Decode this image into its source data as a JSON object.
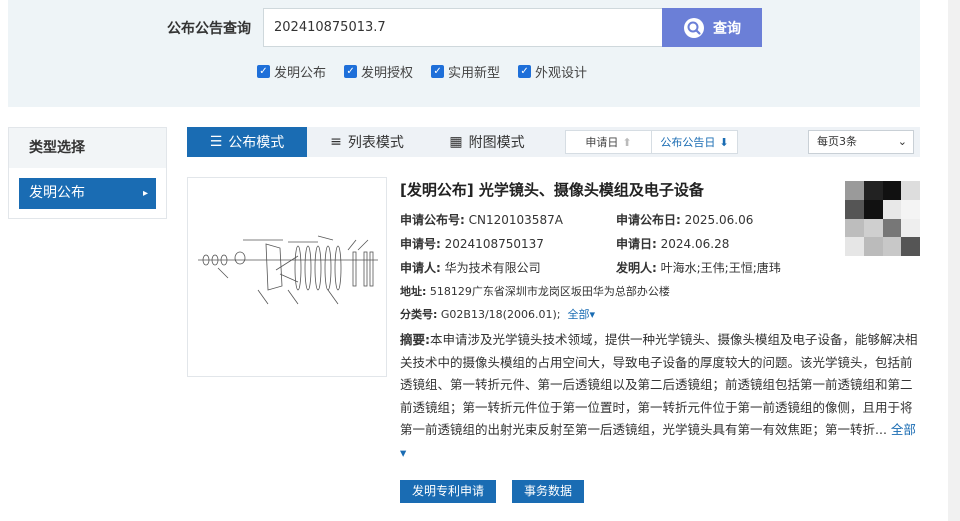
{
  "search": {
    "label": "公布公告查询",
    "value": "202410875013.7",
    "button_label": "查询"
  },
  "filters": [
    {
      "label": "发明公布",
      "checked": true
    },
    {
      "label": "发明授权",
      "checked": true
    },
    {
      "label": "实用新型",
      "checked": true
    },
    {
      "label": "外观设计",
      "checked": true
    }
  ],
  "sidebar": {
    "title": "类型选择",
    "items": [
      {
        "label": "发明公布",
        "active": true
      }
    ]
  },
  "view_modes": [
    {
      "label": "公布模式",
      "icon": "list-icon",
      "active": true
    },
    {
      "label": "列表模式",
      "icon": "menu-icon",
      "active": false
    },
    {
      "label": "附图模式",
      "icon": "grid-icon",
      "active": false
    }
  ],
  "sort": {
    "apply_date": "申请日",
    "pub_date": "公布公告日"
  },
  "per_page": "每页3条",
  "result": {
    "title": "[发明公布] 光学镜头、摄像头模组及电子设备",
    "pub_no_label": "申请公布号:",
    "pub_no": "CN120103587A",
    "pub_date_label": "申请公布日:",
    "pub_date": "2025.06.06",
    "app_no_label": "申请号:",
    "app_no": "2024108750137",
    "app_date_label": "申请日:",
    "app_date": "2024.06.28",
    "applicant_label": "申请人:",
    "applicant": "华为技术有限公司",
    "inventor_label": "发明人:",
    "inventors": "叶海水;王伟;王恒;唐玮",
    "address_label": "地址:",
    "address": "518129广东省深圳市龙岗区坂田华为总部办公楼",
    "class_label": "分类号:",
    "class_no": "G02B13/18(2006.01);",
    "class_all": "全部▾",
    "abstract_label": "摘要:",
    "abstract": "本申请涉及光学镜头技术领域，提供一种光学镜头、摄像头模组及电子设备，能够解决相关技术中的摄像头模组的占用空间大，导致电子设备的厚度较大的问题。该光学镜头，包括前透镜组、第一转折元件、第一后透镜组以及第二后透镜组；前透镜组包括第一前透镜组和第二前透镜组；第一转折元件位于第一位置时，第一转折元件位于第一前透镜组的像侧，且用于将第一前透镜组的出射光束反射至第一后透镜组，光学镜头具有第一有效焦距；第一转折...",
    "abstract_all": "全部▾"
  },
  "actions": {
    "apply_label": "发明专利申请",
    "affairs_label": "事务数据"
  },
  "colors": {
    "primary": "#1a6cb3",
    "search_button": "#6b7fd7",
    "panel_bg": "#eef4f7"
  }
}
